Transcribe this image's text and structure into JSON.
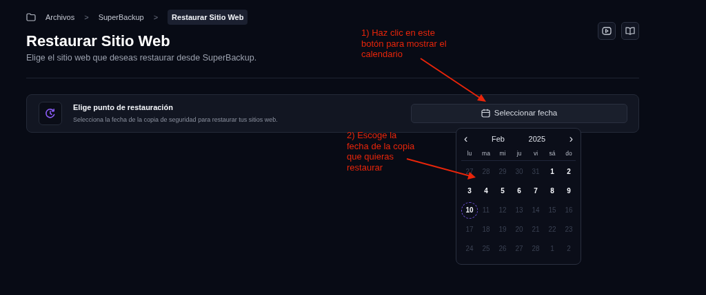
{
  "breadcrumb": [
    {
      "label": "Archivos",
      "selected": false
    },
    {
      "label": "SuperBackup",
      "selected": false
    },
    {
      "label": "Restaurar Sitio Web",
      "selected": true
    }
  ],
  "breadcrumb_separator": ">",
  "header": {
    "title": "Restaurar Sitio Web",
    "subtitle": "Elige el sitio web que deseas restaurar desde SuperBackup."
  },
  "restore_card": {
    "title": "Elige punto de restauración",
    "description": "Selecciona la fecha de la copia de seguridad para restaurar tus sitios web.",
    "button": "Seleccionar fecha"
  },
  "calendar": {
    "prev": "‹",
    "month": "Feb",
    "year": "2025",
    "next": "›",
    "weekdays": [
      "lu",
      "ma",
      "mi",
      "ju",
      "vi",
      "sá",
      "do"
    ],
    "days": [
      {
        "label": "27",
        "disabled": true,
        "today": false
      },
      {
        "label": "28",
        "disabled": true,
        "today": false
      },
      {
        "label": "29",
        "disabled": true,
        "today": false
      },
      {
        "label": "30",
        "disabled": true,
        "today": false
      },
      {
        "label": "31",
        "disabled": true,
        "today": false
      },
      {
        "label": "1",
        "disabled": false,
        "today": false
      },
      {
        "label": "2",
        "disabled": false,
        "today": false
      },
      {
        "label": "3",
        "disabled": false,
        "today": false
      },
      {
        "label": "4",
        "disabled": false,
        "today": false
      },
      {
        "label": "5",
        "disabled": false,
        "today": false
      },
      {
        "label": "6",
        "disabled": false,
        "today": false
      },
      {
        "label": "7",
        "disabled": false,
        "today": false
      },
      {
        "label": "8",
        "disabled": false,
        "today": false
      },
      {
        "label": "9",
        "disabled": false,
        "today": false
      },
      {
        "label": "10",
        "disabled": false,
        "today": true
      },
      {
        "label": "11",
        "disabled": true,
        "today": false
      },
      {
        "label": "12",
        "disabled": true,
        "today": false
      },
      {
        "label": "13",
        "disabled": true,
        "today": false
      },
      {
        "label": "14",
        "disabled": true,
        "today": false
      },
      {
        "label": "15",
        "disabled": true,
        "today": false
      },
      {
        "label": "16",
        "disabled": true,
        "today": false
      },
      {
        "label": "17",
        "disabled": true,
        "today": false
      },
      {
        "label": "18",
        "disabled": true,
        "today": false
      },
      {
        "label": "19",
        "disabled": true,
        "today": false
      },
      {
        "label": "20",
        "disabled": true,
        "today": false
      },
      {
        "label": "21",
        "disabled": true,
        "today": false
      },
      {
        "label": "22",
        "disabled": true,
        "today": false
      },
      {
        "label": "23",
        "disabled": true,
        "today": false
      },
      {
        "label": "24",
        "disabled": true,
        "today": false
      },
      {
        "label": "25",
        "disabled": true,
        "today": false
      },
      {
        "label": "26",
        "disabled": true,
        "today": false
      },
      {
        "label": "27",
        "disabled": true,
        "today": false
      },
      {
        "label": "28",
        "disabled": true,
        "today": false
      },
      {
        "label": "1",
        "disabled": true,
        "today": false
      },
      {
        "label": "2",
        "disabled": true,
        "today": false
      }
    ]
  },
  "annotations": [
    {
      "text": "1) Haz clic en este\nbotón para mostrar el\ncalendario"
    },
    {
      "text": "2) Escoge la\nfecha de la copia\nque quieras\nrestaurar"
    }
  ]
}
